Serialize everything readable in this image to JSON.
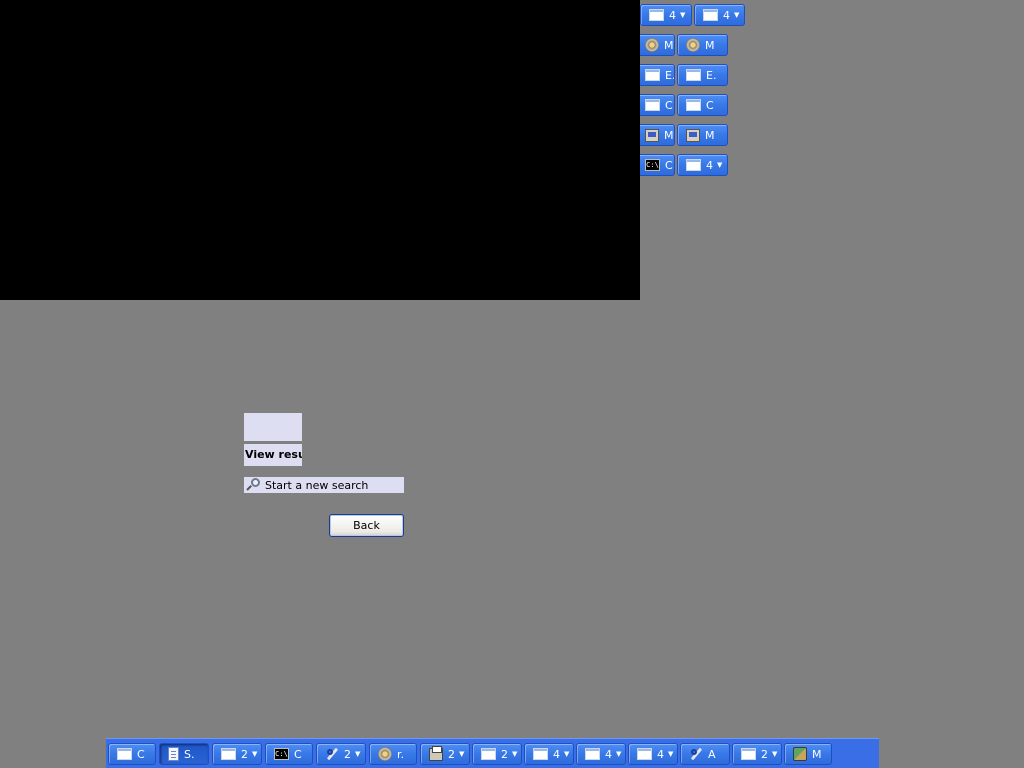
{
  "black_window": {},
  "top_buttons": [
    {
      "icon": "window-icon",
      "label": "4",
      "caret": "▼"
    },
    {
      "icon": "window-icon",
      "label": "4",
      "caret": "▼"
    },
    {
      "icon": "gear-icon",
      "label": "M"
    },
    {
      "icon": "gear-icon",
      "label": "M"
    },
    {
      "icon": "window-icon",
      "label": "E."
    },
    {
      "icon": "window-icon",
      "label": "E."
    },
    {
      "icon": "window-icon",
      "label": "C"
    },
    {
      "icon": "window-icon",
      "label": "C"
    },
    {
      "icon": "monitor-icon",
      "label": "M"
    },
    {
      "icon": "monitor-icon",
      "label": "M"
    },
    {
      "icon": "cmd-icon",
      "label": "C",
      "icon_text": "C:\\"
    },
    {
      "icon": "window-icon",
      "label": "4",
      "caret": "▼"
    }
  ],
  "content": {
    "view_results_label": "View resul",
    "new_search_label": "Start a new search",
    "back_label": "Back"
  },
  "taskbar": {
    "items": [
      {
        "icon": "window-icon",
        "label": "C"
      },
      {
        "icon": "document-icon",
        "label": "S.",
        "active": true
      },
      {
        "icon": "window-icon",
        "label": "2",
        "caret": "▼"
      },
      {
        "icon": "cmd-icon",
        "label": "C",
        "icon_text": "C:\\"
      },
      {
        "icon": "wrench-icon",
        "label": "2",
        "caret": "▼"
      },
      {
        "icon": "gear-icon",
        "label": "r."
      },
      {
        "icon": "printer-icon",
        "label": "2",
        "caret": "▼"
      },
      {
        "icon": "window-icon",
        "label": "2",
        "caret": "▼"
      },
      {
        "icon": "window-icon",
        "label": "4",
        "caret": "▼"
      },
      {
        "icon": "window-icon",
        "label": "4",
        "caret": "▼"
      },
      {
        "icon": "window-icon",
        "label": "4",
        "caret": "▼"
      },
      {
        "icon": "wrench-icon",
        "label": "A"
      },
      {
        "icon": "window-icon",
        "label": "2",
        "caret": "▼"
      },
      {
        "icon": "tools-icon",
        "label": "M"
      }
    ]
  }
}
